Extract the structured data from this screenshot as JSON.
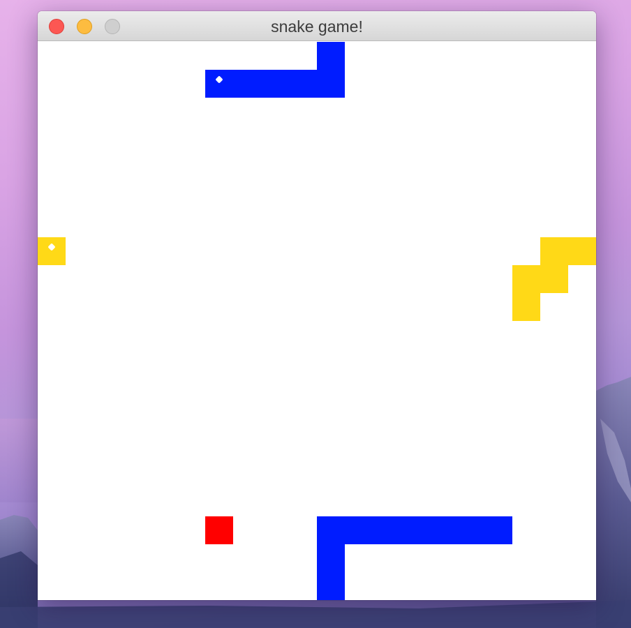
{
  "window": {
    "title": "snake game!"
  },
  "colors": {
    "board_background": "#ffffff",
    "snake_blue": "#001cff",
    "snake_yellow": "#ffd917",
    "food": "#ff0000",
    "eye": "#ffffff"
  },
  "game": {
    "grid": {
      "cols": 20,
      "rows": 20
    },
    "snakes": [
      {
        "name": "blue",
        "color": "#001cff",
        "head": [
          6,
          1
        ],
        "cells": [
          [
            6,
            1
          ],
          [
            7,
            1
          ],
          [
            8,
            1
          ],
          [
            9,
            1
          ],
          [
            10,
            1
          ],
          [
            10,
            0
          ],
          [
            10,
            19
          ],
          [
            10,
            18
          ],
          [
            11,
            17
          ],
          [
            10,
            17
          ],
          [
            12,
            17
          ],
          [
            13,
            17
          ],
          [
            14,
            17
          ],
          [
            15,
            17
          ],
          [
            16,
            17
          ]
        ]
      },
      {
        "name": "yellow",
        "color": "#ffd917",
        "head": [
          0,
          7
        ],
        "cells": [
          [
            0,
            7
          ],
          [
            19,
            7
          ],
          [
            18,
            7
          ],
          [
            18,
            8
          ],
          [
            17,
            8
          ],
          [
            17,
            9
          ]
        ]
      }
    ],
    "food": [
      [
        6,
        17
      ]
    ]
  }
}
